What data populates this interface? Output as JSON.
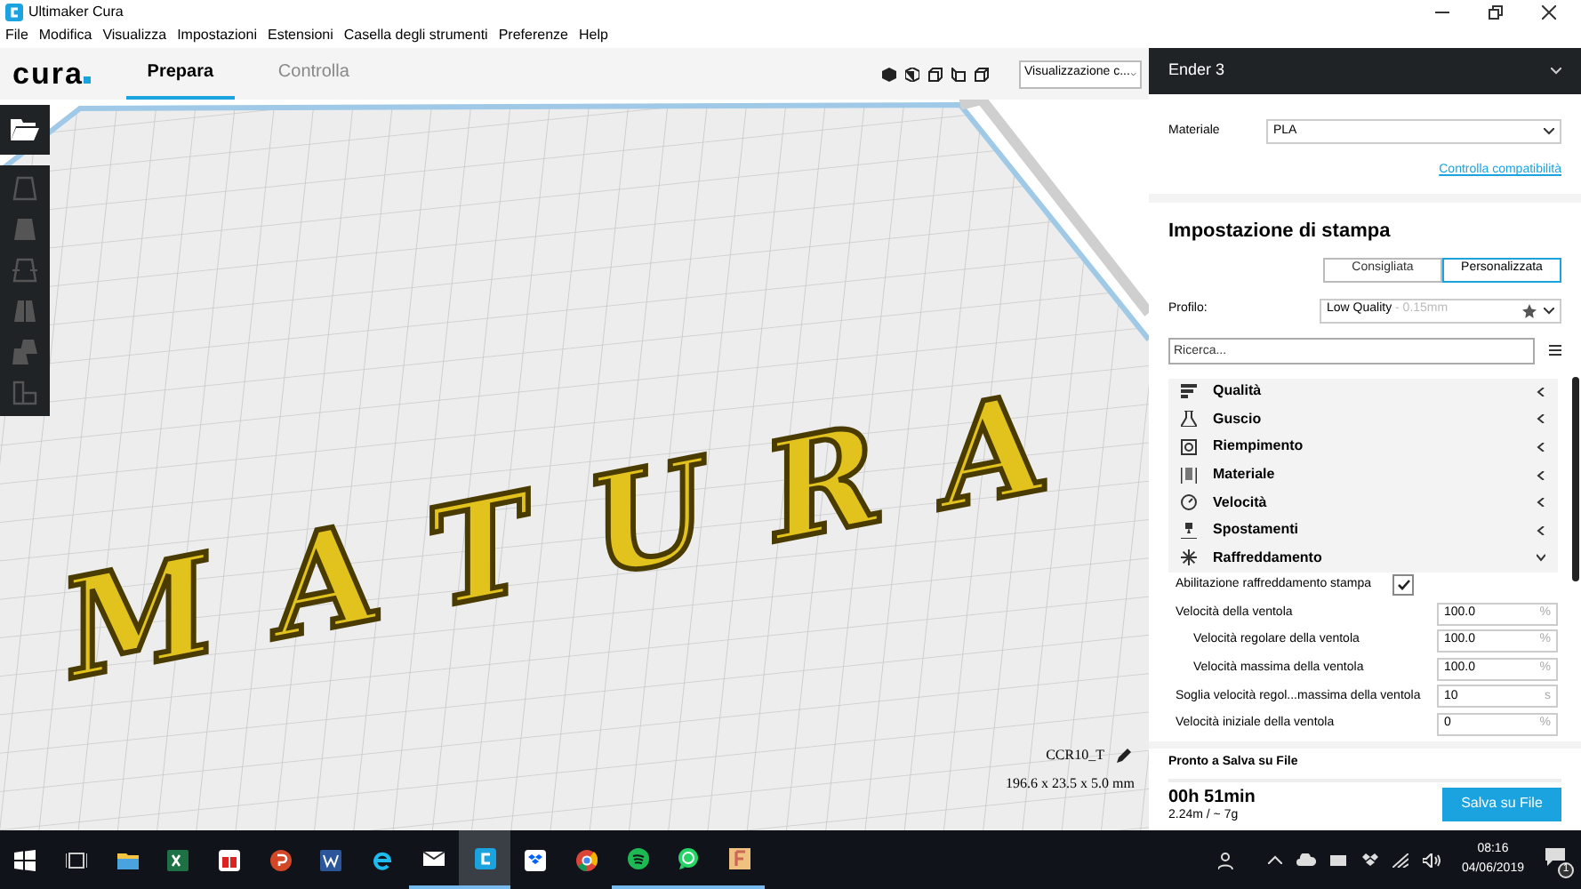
{
  "window": {
    "title": "Ultimaker Cura"
  },
  "menu": [
    "File",
    "Modifica",
    "Visualizza",
    "Impostazioni",
    "Estensioni",
    "Casella degli strumenti",
    "Preferenze",
    "Help"
  ],
  "header": {
    "logo": "cura",
    "tabs": [
      {
        "label": "Prepara",
        "selected": true
      },
      {
        "label": "Controlla",
        "selected": false
      }
    ],
    "view_dropdown": "Visualizzazione c..."
  },
  "viewport": {
    "model_text": "MATURA",
    "object_name": "CCR10_T",
    "object_size": "196.6 x 23.5 x 5.0 mm"
  },
  "printer": {
    "name": "Ender 3"
  },
  "material": {
    "label": "Materiale",
    "value": "PLA",
    "link": "Controlla compatibilità"
  },
  "print_settings": {
    "title": "Impostazione di stampa",
    "modes": [
      {
        "label": "Consigliata",
        "selected": false
      },
      {
        "label": "Personalizzata",
        "selected": true
      }
    ],
    "profile": {
      "label": "Profilo:",
      "value": "Low Quality",
      "detail": " - 0.15mm"
    },
    "search": {
      "placeholder": "Ricerca..."
    },
    "categories": [
      {
        "label": "Qualità",
        "expanded": false
      },
      {
        "label": "Guscio",
        "expanded": false
      },
      {
        "label": "Riempimento",
        "expanded": false
      },
      {
        "label": "Materiale",
        "expanded": false
      },
      {
        "label": "Velocità",
        "expanded": false
      },
      {
        "label": "Spostamenti",
        "expanded": false
      },
      {
        "label": "Raffreddamento",
        "expanded": true,
        "settings": [
          {
            "kind": "checkbox",
            "label": "Abilitazione raffreddamento stampa",
            "checked": true
          },
          {
            "kind": "field",
            "label": "Velocità della ventola",
            "value": "100.0",
            "unit": "%",
            "children": [
              {
                "kind": "field",
                "label": "Velocità regolare della ventola",
                "value": "100.0",
                "unit": "%"
              },
              {
                "kind": "field",
                "label": "Velocità massima della ventola",
                "value": "100.0",
                "unit": "%"
              }
            ]
          },
          {
            "kind": "field",
            "label": "Soglia velocità regol...massima della ventola",
            "value": "10",
            "unit": "s"
          },
          {
            "kind": "field",
            "label": "Velocità iniziale della ventola",
            "value": "0",
            "unit": "%"
          }
        ]
      }
    ]
  },
  "output": {
    "status": "Pronto a Salva su File",
    "time": "00h 51min",
    "usage": "2.24m / ~ 7g",
    "button": "Salva su File"
  },
  "taskbar": {
    "apps": [
      {
        "running": false,
        "selected": false
      },
      {
        "running": false,
        "selected": false
      },
      {
        "running": false,
        "selected": false
      },
      {
        "running": false,
        "selected": false
      },
      {
        "running": false,
        "selected": false
      },
      {
        "running": false,
        "selected": false
      },
      {
        "running": false,
        "selected": false
      },
      {
        "running": true,
        "selected": false
      },
      {
        "running": true,
        "selected": true
      },
      {
        "running": false,
        "selected": false
      },
      {
        "running": false,
        "selected": false
      },
      {
        "running": true,
        "selected": false
      },
      {
        "running": true,
        "selected": false
      },
      {
        "running": true,
        "selected": false
      }
    ],
    "time": "08:16",
    "date": "04/06/2019",
    "notifications": "1"
  }
}
